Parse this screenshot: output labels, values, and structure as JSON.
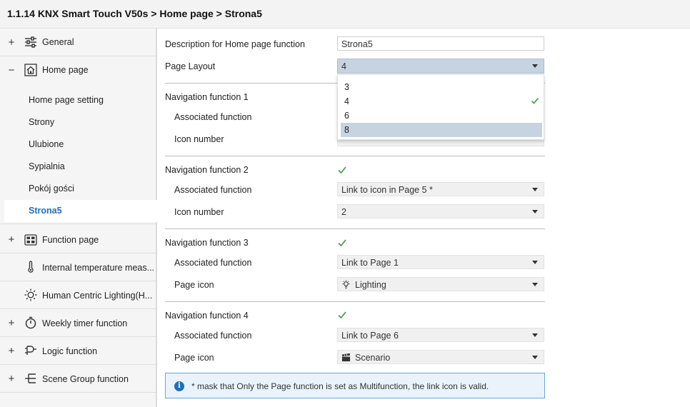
{
  "title": "1.1.14 KNX Smart Touch V50s > Home page > Strona5",
  "sidebar": {
    "items": [
      {
        "label": "General",
        "expander": "+",
        "icon": "sliders-icon"
      },
      {
        "label": "Home page",
        "expander": "−",
        "icon": "home-icon"
      },
      {
        "label": "Function page",
        "expander": "+",
        "icon": "grid-icon"
      },
      {
        "label": "Internal temperature meas...",
        "expander": "",
        "icon": "thermometer-icon"
      },
      {
        "label": "Human Centric Lighting(H...",
        "expander": "",
        "icon": "sun-icon"
      },
      {
        "label": "Weekly timer function",
        "expander": "+",
        "icon": "timer-icon"
      },
      {
        "label": "Logic function",
        "expander": "+",
        "icon": "logic-icon"
      },
      {
        "label": "Scene Group function",
        "expander": "+",
        "icon": "scene-group-icon"
      }
    ],
    "subitems": [
      {
        "label": "Home page setting"
      },
      {
        "label": "Strony"
      },
      {
        "label": "Ulubione"
      },
      {
        "label": "Sypialnia"
      },
      {
        "label": "Pokój gości"
      },
      {
        "label": "Strona5",
        "active": true
      }
    ]
  },
  "main": {
    "description_label": "Description for Home page function",
    "description_value": "Strona5",
    "page_layout_label": "Page Layout",
    "page_layout_value": "4",
    "page_layout_options": [
      "3",
      "4",
      "6",
      "8"
    ],
    "page_layout_highlighted": "8",
    "nav1": {
      "label": "Navigation function 1",
      "assoc_label": "Associated function",
      "icon_number_label": "Icon number"
    },
    "nav2": {
      "label": "Navigation function 2",
      "assoc_label": "Associated function",
      "assoc_value": "Link to icon in Page 5 *",
      "icon_number_label": "Icon number",
      "icon_number_value": "2"
    },
    "nav3": {
      "label": "Navigation function 3",
      "assoc_label": "Associated function",
      "assoc_value": "Link to Page 1",
      "page_icon_label": "Page icon",
      "page_icon_value": "Lighting"
    },
    "nav4": {
      "label": "Navigation function 4",
      "assoc_label": "Associated function",
      "assoc_value": "Link to Page 6",
      "page_icon_label": "Page icon",
      "page_icon_value": "Scenario"
    },
    "info_text": "* mask that Only the Page function is set as Multifunction, the link icon is valid."
  },
  "colors": {
    "accent": "#1f6fb8",
    "check": "#5aa05a",
    "highlight": "#c6d3e0"
  }
}
